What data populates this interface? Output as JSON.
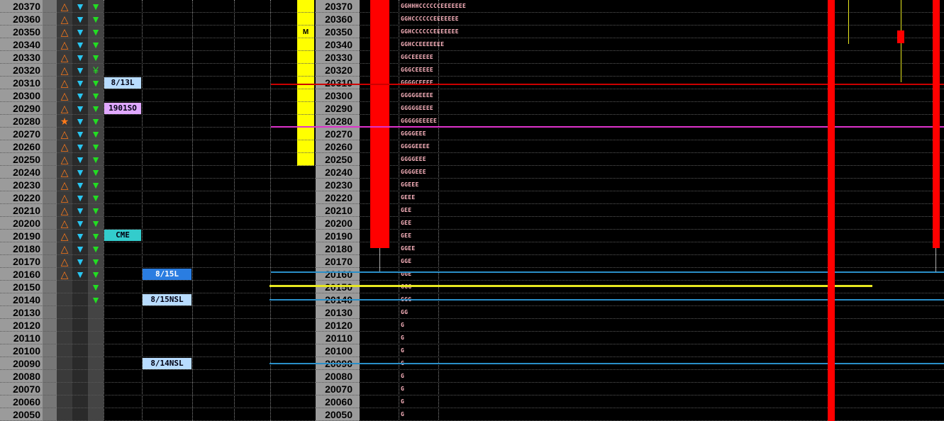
{
  "prices": [
    "20370",
    "20360",
    "20350",
    "20340",
    "20330",
    "20320",
    "20310",
    "20300",
    "20290",
    "20280",
    "20270",
    "20260",
    "20250",
    "20240",
    "20230",
    "20220",
    "20210",
    "20200",
    "20190",
    "20180",
    "20170",
    "20160",
    "20150",
    "20140",
    "20130",
    "20120",
    "20110",
    "20100",
    "20090",
    "20080",
    "20070",
    "20060",
    "20050"
  ],
  "tpo_rows": [
    "GGHHHCCCCCCEEEEEEE",
    "GGHCCCCCCEEEEEEE",
    "GGHCCCCCCEEEEEEE",
    "GGHCCEEEEEEE",
    "GGCEEEEEE",
    "GGGCEEEEE",
    "GGGGCEEEE",
    "GGGGGEEEE",
    "GGGGGEEEE",
    "GGGGGEEEEE",
    "GGGGEEE",
    "GGGGEEEE",
    "GGGGEEE",
    "GGGGEEE",
    "GGEEE",
    "GEEE",
    "GEE",
    "GEE",
    "GEE",
    "GGEE",
    "GGE",
    "GGE",
    "GGG",
    "GGG",
    "GG",
    "G",
    "G",
    "G",
    "G",
    "G",
    "G",
    "G",
    "G"
  ],
  "icons": {
    "up_triangle": "△",
    "up_star": "★",
    "down_triangle": "▼",
    "green_triangle": "▼",
    "green_special": "¥"
  },
  "markers": {
    "m_label": "M"
  },
  "tags": {
    "t_813l": "8/13L",
    "t_1901": "1901SO",
    "t_cme": "CME",
    "t_815l": "8/15L",
    "t_815nsl": "8/15NSL",
    "t_814nsl": "8/14NSL"
  },
  "colors": {
    "tag_light_blue": "#b8dcff",
    "tag_purple": "#e0a8ff",
    "tag_cyan": "#33cccc",
    "tag_blue": "#2a7de1",
    "red_line": "#cc0000",
    "magenta_line": "#dd33cc",
    "blue_line": "#2a8fc8",
    "yellow_line": "#e8e820",
    "red_bar": "#ff0000",
    "yellow_column": "#ffff00"
  }
}
